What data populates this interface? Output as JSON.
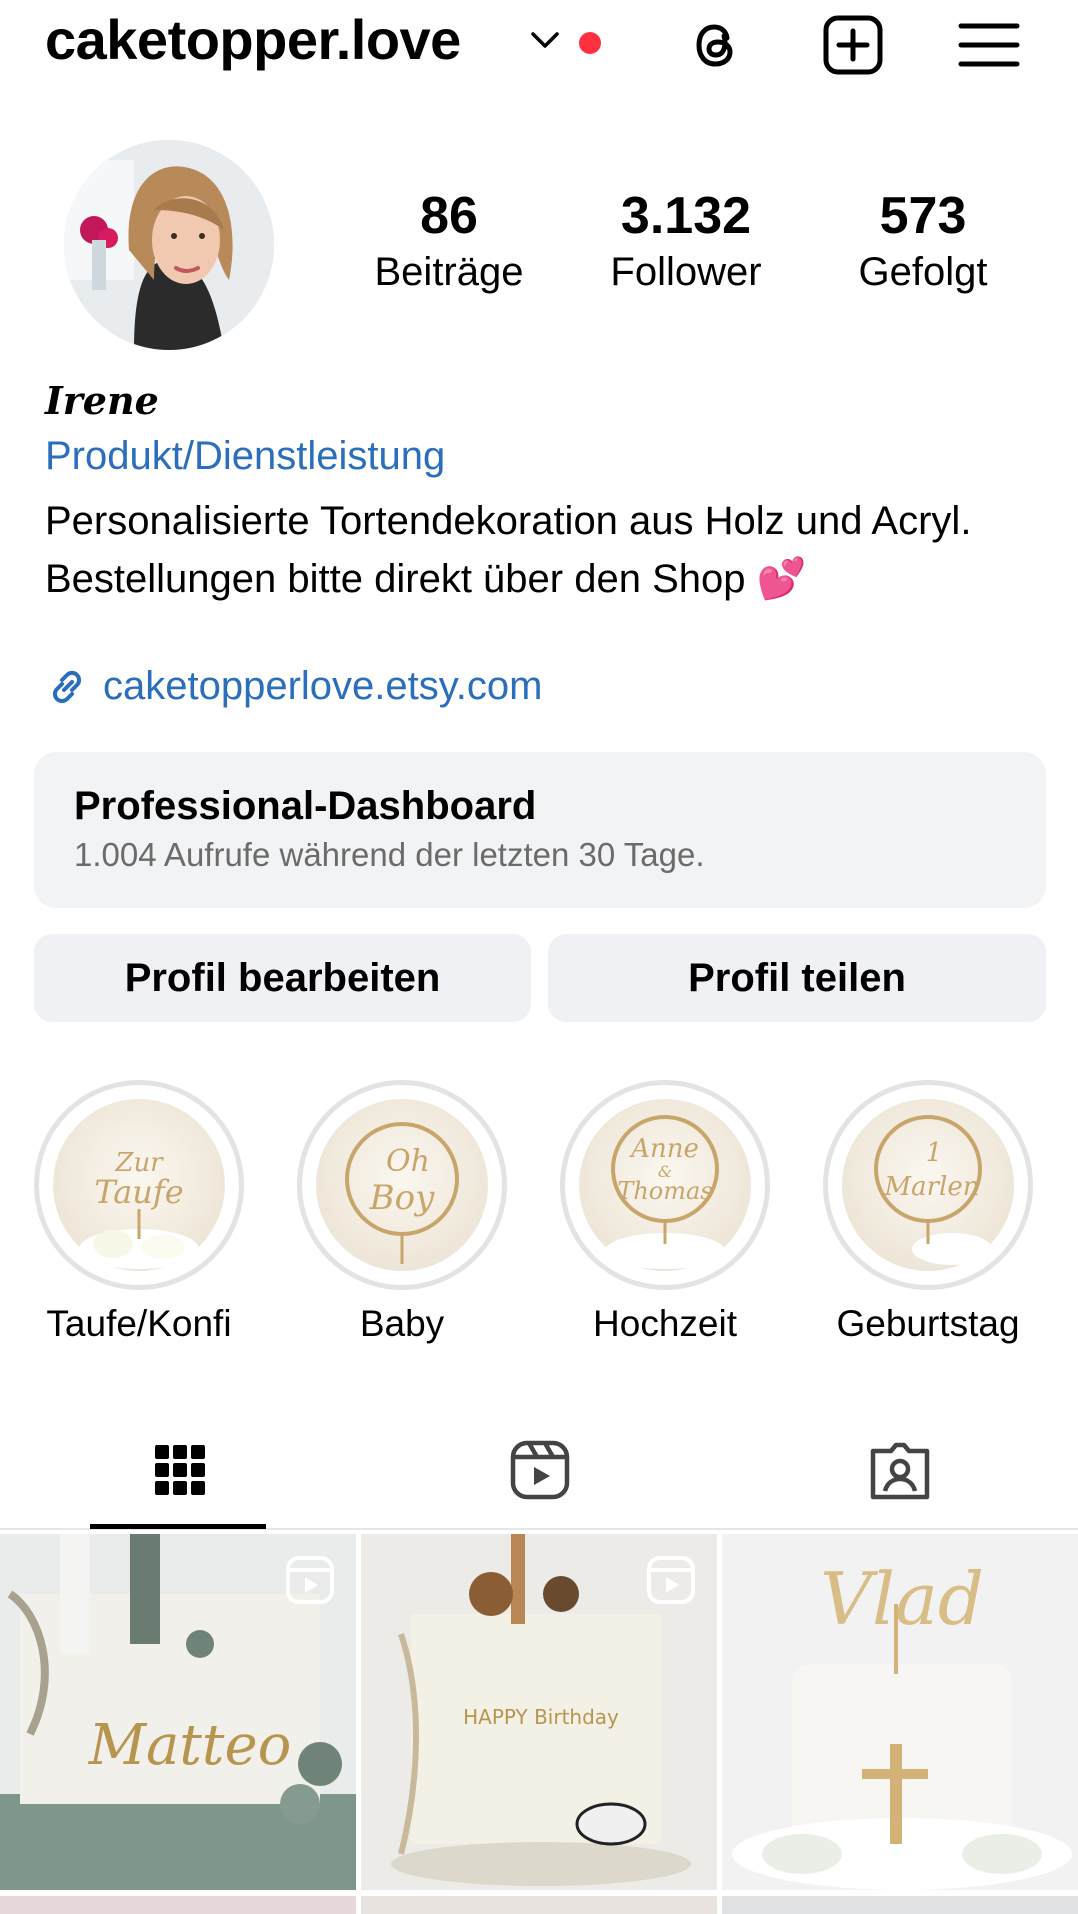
{
  "header": {
    "username": "caketopper.love",
    "icons": [
      "chevron-down-icon",
      "threads-icon",
      "create-post-icon",
      "menu-icon"
    ],
    "notification_color": "#ff3040"
  },
  "profile": {
    "stats": [
      {
        "value": "86",
        "label": "Beiträge"
      },
      {
        "value": "3.132",
        "label": "Follower"
      },
      {
        "value": "573",
        "label": "Gefolgt"
      }
    ]
  },
  "bio": {
    "name": "Irene",
    "category": "Produkt/Dienstleistung",
    "line1": "Personalisierte Tortendekoration aus Holz und Acryl.",
    "line2": "Bestellungen bitte direkt über den Shop 💕",
    "link": "caketopperlove.etsy.com",
    "link_color": "#2a6ebd"
  },
  "dashboard": {
    "title": "Professional-Dashboard",
    "subtitle": "1.004 Aufrufe während der letzten 30 Tage."
  },
  "buttons": {
    "edit": "Profil bearbeiten",
    "share": "Profil teilen"
  },
  "highlights": [
    {
      "label": "Taufe/Konfi",
      "topper": "Zur Taufe"
    },
    {
      "label": "Baby",
      "topper": "Oh Boy"
    },
    {
      "label": "Hochzeit",
      "topper": "Anne & Thomas"
    },
    {
      "label": "Geburtstag",
      "topper": "1 Marlen"
    }
  ],
  "tabs": [
    "grid-icon",
    "reels-icon",
    "tagged-icon"
  ],
  "posts": [
    {
      "type": "reel",
      "caption_on_image": "Matteo"
    },
    {
      "type": "reel",
      "caption_on_image": "HAPPY Birthday"
    },
    {
      "type": "photo",
      "caption_on_image": "Vlad"
    }
  ]
}
